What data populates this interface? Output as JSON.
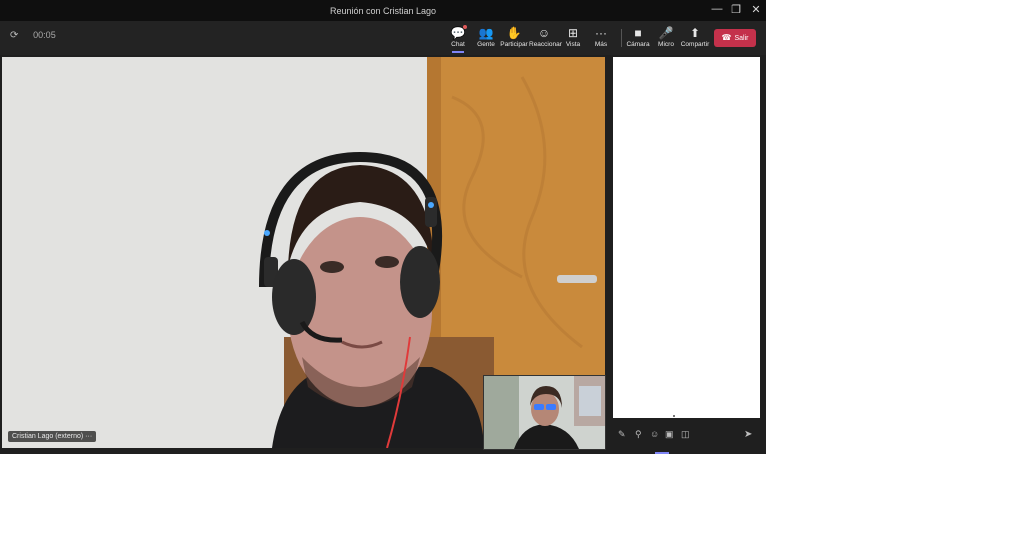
{
  "window": {
    "title": "Reunión con Cristian Lago",
    "controls": [
      "—",
      "❐",
      "✕"
    ]
  },
  "toolbar": {
    "timer": "00:05",
    "buttons": [
      {
        "label": "Chat",
        "icon": "chat-icon",
        "glyph": "💬"
      },
      {
        "label": "Gente",
        "icon": "people-icon",
        "glyph": "👥"
      },
      {
        "label": "Participar",
        "icon": "raise-hand-icon",
        "glyph": "✋"
      },
      {
        "label": "Reaccionar",
        "icon": "reaction-icon",
        "glyph": "☺"
      },
      {
        "label": "Vista",
        "icon": "view-icon",
        "glyph": "⊞"
      },
      {
        "label": "Más",
        "icon": "more-icon",
        "glyph": "···"
      },
      {
        "label": "Cámara",
        "icon": "camera-icon",
        "glyph": "■"
      },
      {
        "label": "Micro",
        "icon": "mic-icon",
        "glyph": "🎤"
      },
      {
        "label": "Compartir",
        "icon": "share-icon",
        "glyph": "⬆"
      }
    ],
    "leave_label": "Salir"
  },
  "stage": {
    "participant_name": "Cristian Lago (externo)",
    "more_glyph": "···"
  },
  "chat": {
    "compose_icons": [
      "format-icon",
      "attach-icon",
      "emoji-icon",
      "gif-icon",
      "sticker-icon"
    ],
    "send_icon": "send-icon"
  },
  "colors": {
    "accent": "#7f85f5",
    "leave": "#c4314b",
    "toolbar": "#232323",
    "titlebar": "#0f0f0f"
  }
}
